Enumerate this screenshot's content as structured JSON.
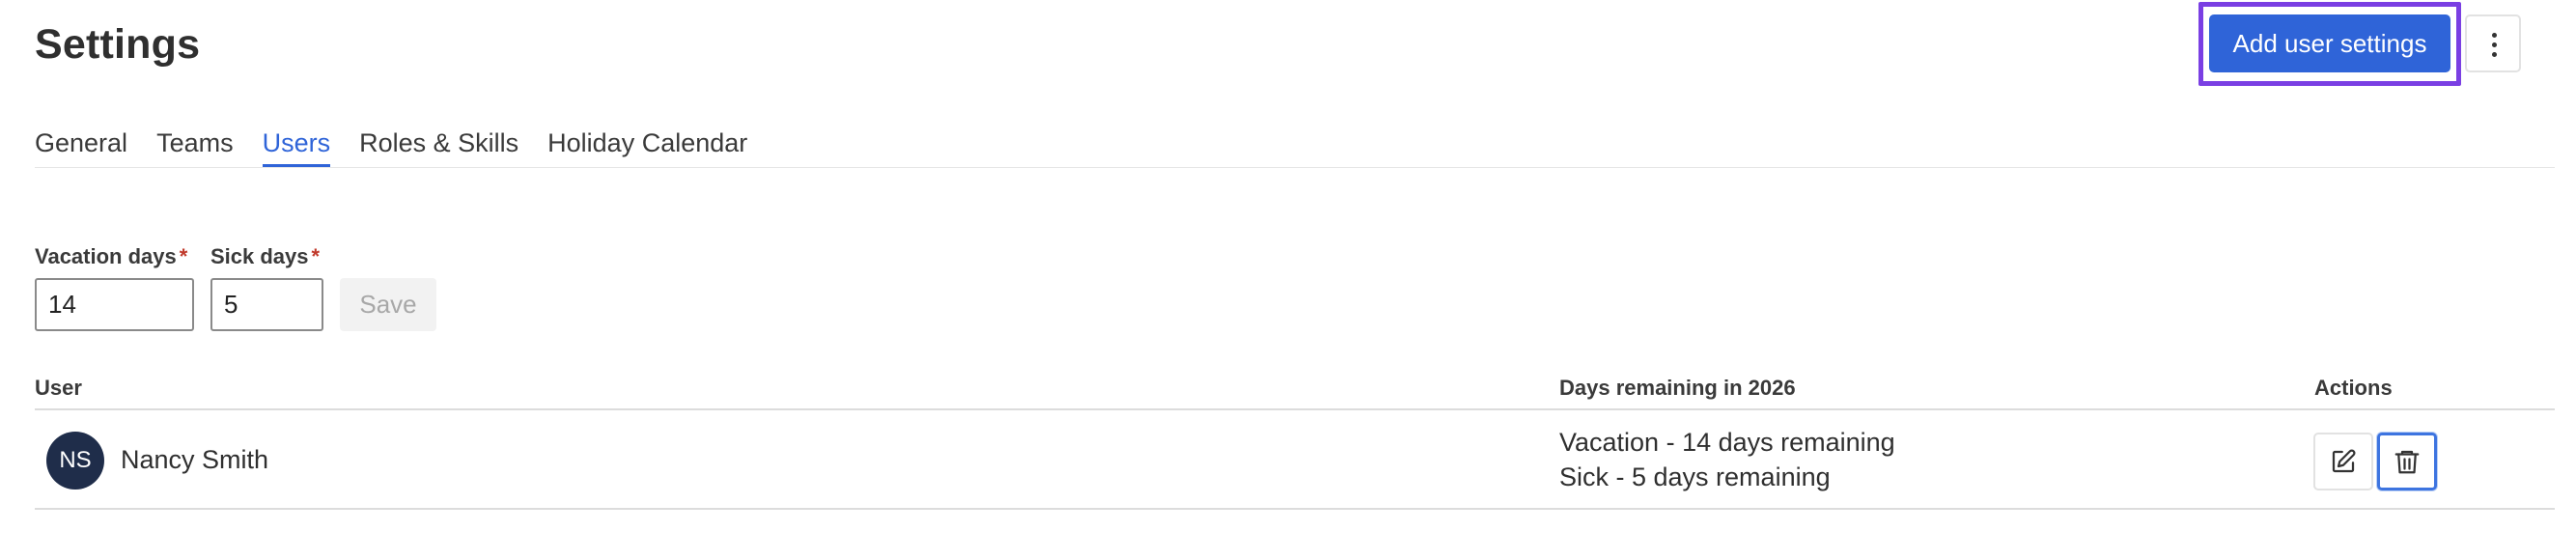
{
  "header": {
    "title": "Settings",
    "primary_action_label": "Add user settings",
    "more_options_icon": "more-vertical-icon"
  },
  "tabs": [
    {
      "label": "General",
      "active": false
    },
    {
      "label": "Teams",
      "active": false
    },
    {
      "label": "Users",
      "active": true
    },
    {
      "label": "Roles & Skills",
      "active": false
    },
    {
      "label": "Holiday Calendar",
      "active": false
    }
  ],
  "form": {
    "vacation": {
      "label": "Vacation days",
      "required_mark": "*",
      "value": "14"
    },
    "sick": {
      "label": "Sick days",
      "required_mark": "*",
      "value": "5"
    },
    "save_label": "Save"
  },
  "table": {
    "columns": [
      "User",
      "Days remaining in 2026",
      "Actions"
    ],
    "rows": [
      {
        "initials": "NS",
        "name": "Nancy Smith",
        "remaining": [
          "Vacation - 14 days remaining",
          "Sick - 5 days remaining"
        ],
        "actions": [
          "edit-icon",
          "trash-icon"
        ]
      }
    ]
  },
  "colors": {
    "accent": "#2f64d8",
    "focus_ring": "#7a3fe3",
    "avatar_bg": "#1f2d4a",
    "required": "#c0392b"
  }
}
